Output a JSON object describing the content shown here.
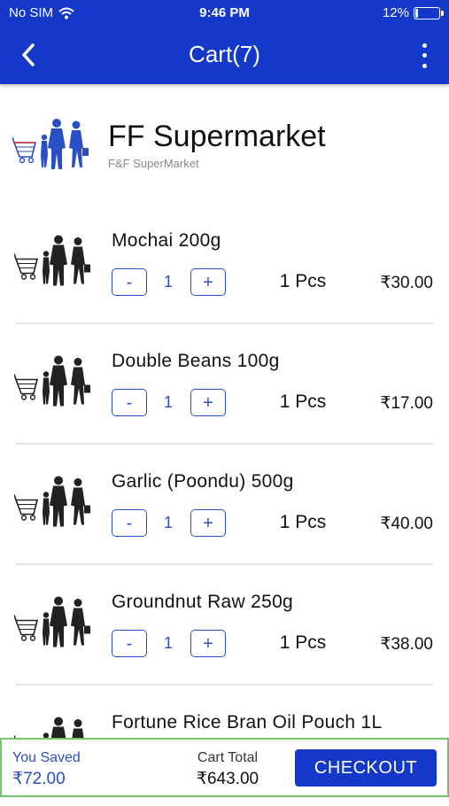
{
  "status_bar": {
    "carrier": "No SIM",
    "time": "9:46 PM",
    "battery_text": "12%",
    "battery_level": 0.12,
    "icons": [
      "wifi-icon",
      "battery-icon"
    ]
  },
  "nav": {
    "title": "Cart(7)",
    "back_icon": "chevron-left-icon",
    "more_icon": "more-vertical-icon"
  },
  "store": {
    "name": "FF Supermarket",
    "subtitle": "F&F SuperMarket"
  },
  "items": [
    {
      "name": "Mochai 200g",
      "qty": "1",
      "unit": "1 Pcs",
      "price": "₹30.00",
      "minus": "-",
      "plus": "+"
    },
    {
      "name": "Double Beans 100g",
      "qty": "1",
      "unit": "1 Pcs",
      "price": "₹17.00",
      "minus": "-",
      "plus": "+"
    },
    {
      "name": "Garlic (Poondu) 500g",
      "qty": "1",
      "unit": "1 Pcs",
      "price": "₹40.00",
      "minus": "-",
      "plus": "+"
    },
    {
      "name": "Groundnut Raw 250g",
      "qty": "1",
      "unit": "1 Pcs",
      "price": "₹38.00",
      "minus": "-",
      "plus": "+"
    },
    {
      "name": "Fortune Rice Bran Oil Pouch 1L"
    }
  ],
  "footer": {
    "saved_label": "You Saved",
    "saved_value": "₹72.00",
    "total_label": "Cart Total",
    "total_value": "₹643.00",
    "checkout_label": "CHECKOUT"
  },
  "colors": {
    "primary": "#1439c9",
    "accent_blue": "#2a4fc4",
    "footer_border": "#74c56a"
  }
}
